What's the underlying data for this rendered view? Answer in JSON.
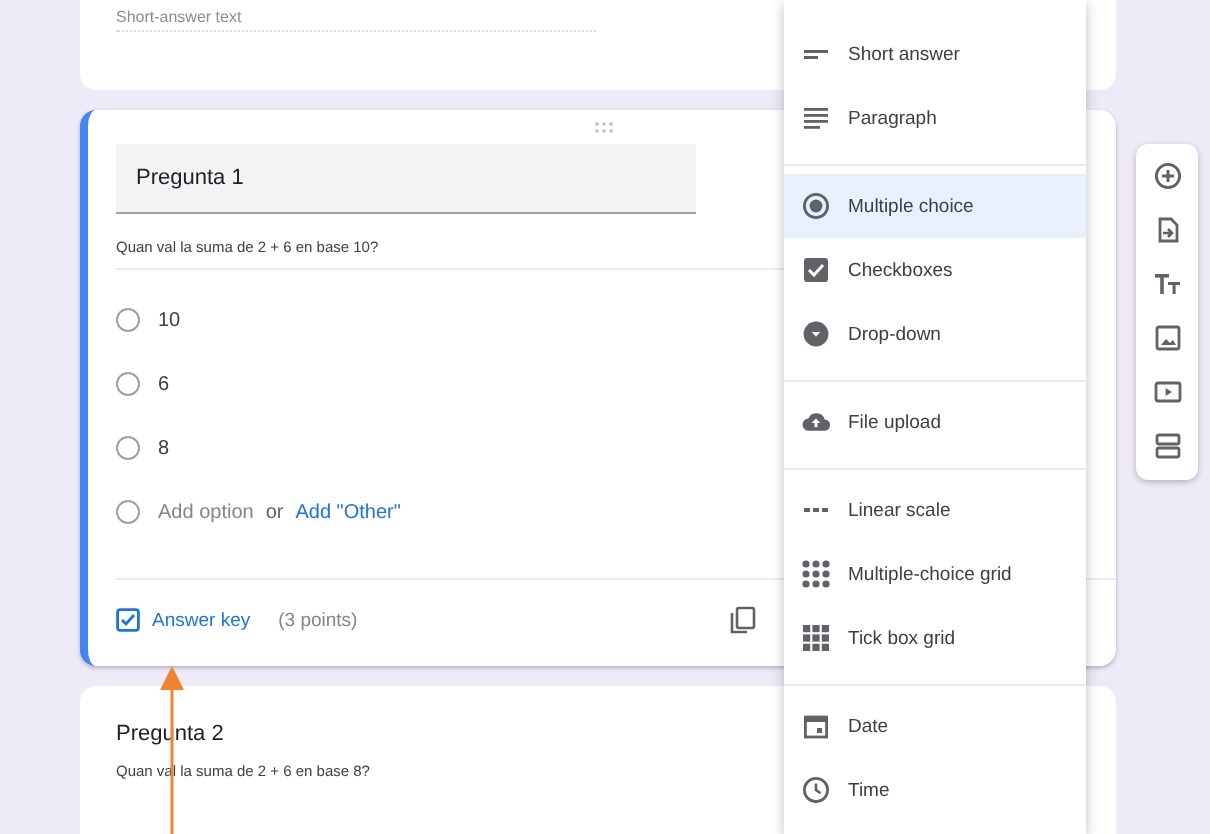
{
  "previous_card": {
    "placeholder": "Short-answer text"
  },
  "question_card": {
    "title": "Pregunta 1",
    "description": "Quan val la suma de 2 + 6 en base 10?",
    "options": [
      {
        "label": "10",
        "selected": false
      },
      {
        "label": "6",
        "selected": false
      },
      {
        "label": "8",
        "selected": false
      }
    ],
    "add_option": "Add option",
    "or": "or",
    "add_other": "Add \"Other\"",
    "answer_key": "Answer key",
    "points": "(3 points)"
  },
  "next_card": {
    "title": "Pregunta 2",
    "description": "Quan val la suma de 2 + 6 en base 8?"
  },
  "type_menu": {
    "groups": [
      [
        {
          "kind": "short",
          "label": "Short answer",
          "selected": false
        },
        {
          "kind": "paragraph",
          "label": "Paragraph",
          "selected": false
        }
      ],
      [
        {
          "kind": "radio",
          "label": "Multiple choice",
          "selected": true
        },
        {
          "kind": "checkbox",
          "label": "Checkboxes",
          "selected": false
        },
        {
          "kind": "dropdown",
          "label": "Drop-down",
          "selected": false
        }
      ],
      [
        {
          "kind": "upload",
          "label": "File upload",
          "selected": false
        }
      ],
      [
        {
          "kind": "scale",
          "label": "Linear scale",
          "selected": false
        },
        {
          "kind": "grid",
          "label": "Multiple-choice grid",
          "selected": false
        },
        {
          "kind": "boxgrid",
          "label": "Tick box grid",
          "selected": false
        }
      ],
      [
        {
          "kind": "date",
          "label": "Date",
          "selected": false
        },
        {
          "kind": "time",
          "label": "Time",
          "selected": false
        }
      ]
    ]
  },
  "side_toolbar": {
    "tools": [
      {
        "kind": "add"
      },
      {
        "kind": "import"
      },
      {
        "kind": "title"
      },
      {
        "kind": "image"
      },
      {
        "kind": "video"
      },
      {
        "kind": "section"
      }
    ]
  }
}
